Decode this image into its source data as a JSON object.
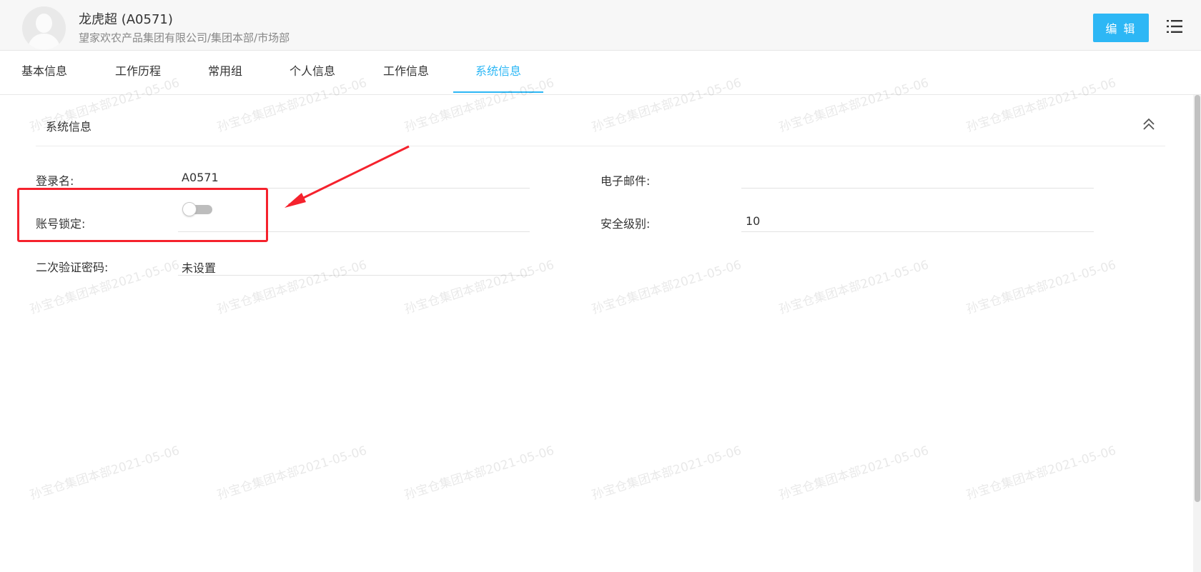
{
  "header": {
    "user_name": "龙虎超 (A0571)",
    "org_path": "望家欢农产品集团有限公司/集团本部/市场部",
    "edit_label": "编 辑",
    "avatar_icon": "user-avatar-icon",
    "menu_icon": "list-menu-icon"
  },
  "tabs": [
    {
      "label": "基本信息",
      "active": false
    },
    {
      "label": "工作历程",
      "active": false
    },
    {
      "label": "常用组",
      "active": false
    },
    {
      "label": "个人信息",
      "active": false
    },
    {
      "label": "工作信息",
      "active": false
    },
    {
      "label": "系统信息",
      "active": true
    }
  ],
  "section": {
    "title": "系统信息",
    "collapse_icon": "double-chevron-up-icon"
  },
  "fields": {
    "login_name": {
      "label": "登录名:",
      "value": "A0571"
    },
    "account_lock": {
      "label": "账号锁定:",
      "enabled": false
    },
    "two_factor": {
      "label": "二次验证密码:",
      "value": "未设置"
    },
    "email": {
      "label": "电子邮件:",
      "value": ""
    },
    "security_level": {
      "label": "安全级别:",
      "value": "10"
    }
  },
  "watermark": {
    "text": "孙宝仓集团本部2021-05-06"
  },
  "colors": {
    "accent": "#2db7f5",
    "annotation": "#f5222d",
    "header_bg": "#f7f7f7"
  }
}
